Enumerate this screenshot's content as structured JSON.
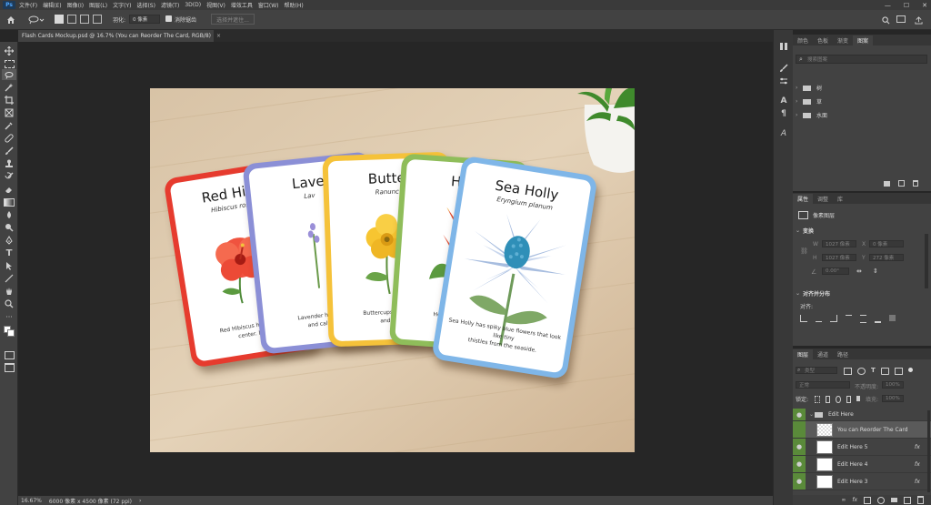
{
  "menu": {
    "logo": "Ps",
    "items": [
      "文件(F)",
      "编辑(E)",
      "图像(I)",
      "图层(L)",
      "文字(Y)",
      "选择(S)",
      "滤镜(T)",
      "3D(D)",
      "视图(V)",
      "增效工具",
      "窗口(W)",
      "帮助(H)"
    ],
    "min": "—",
    "max": "☐",
    "close": "✕"
  },
  "options": {
    "feather_label": "羽化:",
    "feather_value": "0 像素",
    "antialias_label": "消除锯齿",
    "select_subject": "选择并遮住..."
  },
  "document": {
    "tab_title": "Flash Cards Mockup.psd @ 16.7% (You can Reorder The Card, RGB/8)",
    "tab_close": "×"
  },
  "status": {
    "zoom": "16.67%",
    "size": "6000 像素 x 4500 像素 (72 ppi)",
    "arrow": "›"
  },
  "cards": [
    {
      "title": "Red Hibi",
      "subtitle": "Hibiscus rosa",
      "desc": "Red Hibiscus has wide,\ncenter. It i",
      "border": "#e63b2e"
    },
    {
      "title": "Lave",
      "subtitle": "Lav",
      "desc": "Lavender has tiny\nand calmin",
      "border": "#8b8fd6"
    },
    {
      "title": "Butte",
      "subtitle": "Ranunc",
      "desc": "Buttercups are shiny\nand brig",
      "border": "#f5c23a"
    },
    {
      "title": "Heli",
      "subtitle": "",
      "desc": "Heliconia has lo\nred an",
      "border": "#8fbd5a"
    },
    {
      "title": "Sea Holly",
      "subtitle": "Eryngium planum",
      "desc": "Sea Holly has spiky blue flowers that look like tiny\nthistles from the seaside.",
      "border": "#7fb6e8"
    }
  ],
  "swatch_panel": {
    "tabs": [
      "颜色",
      "色板",
      "渐变",
      "图案"
    ],
    "search_placeholder": "搜索图案",
    "groups": [
      "树",
      "草",
      "水面"
    ]
  },
  "properties_panel": {
    "tabs": [
      "属性",
      "调整",
      "库"
    ],
    "type": "像素图层",
    "transform_title": "变换",
    "w_label": "W",
    "w_value": "1027 像素",
    "x_label": "X",
    "x_value": "0 像素",
    "h_label": "H",
    "h_value": "1027 像素",
    "y_label": "Y",
    "y_value": "272 像素",
    "angle_value": "0.00°",
    "align_title": "对齐并分布",
    "align_label": "对齐:"
  },
  "layers_panel": {
    "tabs": [
      "图层",
      "通道",
      "路径"
    ],
    "kind": "类型",
    "blend": "正常",
    "opacity_label": "不透明度:",
    "opacity_value": "100%",
    "lock_label": "锁定:",
    "fill_label": "填充:",
    "fill_value": "100%",
    "fx": "fx",
    "layers": [
      {
        "name": "Edit Here",
        "type": "group"
      },
      {
        "name": "You can Reorder The Card",
        "type": "layer"
      },
      {
        "name": "Edit Here 5",
        "type": "smart"
      },
      {
        "name": "Edit Here 4",
        "type": "smart"
      },
      {
        "name": "Edit Here 3",
        "type": "smart"
      }
    ]
  }
}
